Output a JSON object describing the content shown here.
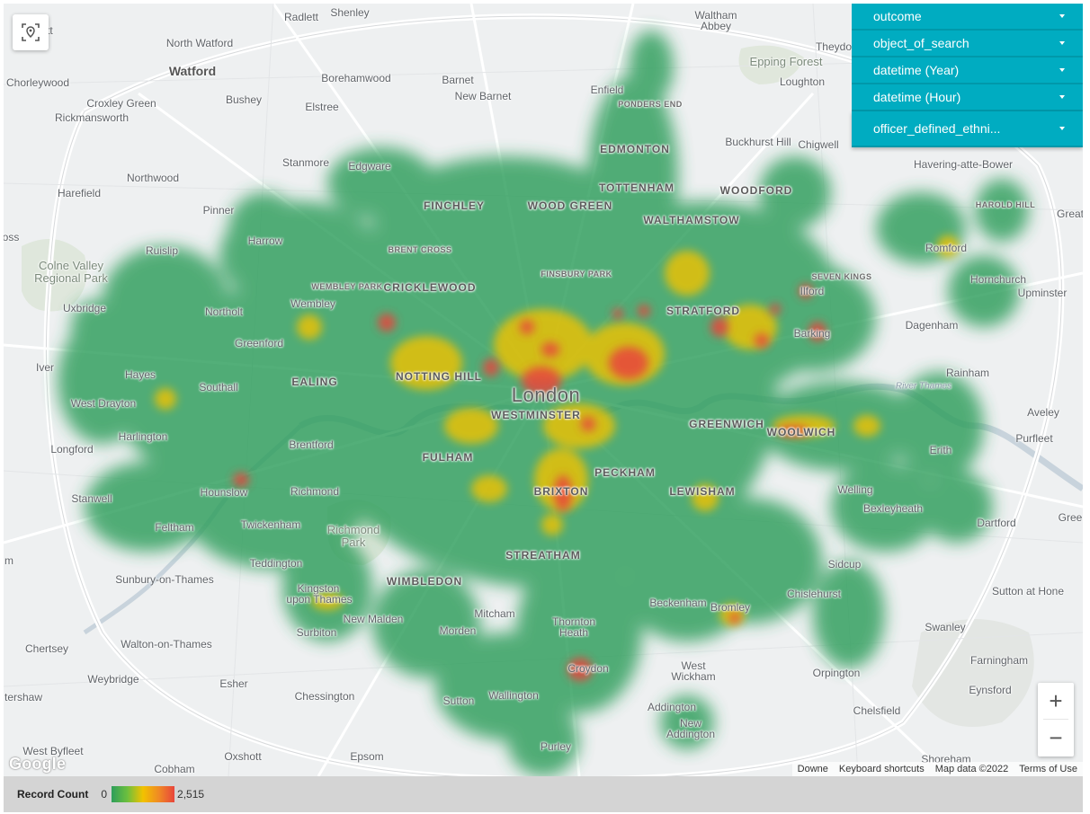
{
  "filters": [
    {
      "label": "outcome"
    },
    {
      "label": "object_of_search"
    },
    {
      "label": "datetime (Year)"
    },
    {
      "label": "datetime (Hour)"
    },
    {
      "label": "officer_defined_ethni..."
    }
  ],
  "legend": {
    "title": "Record Count",
    "min": "0",
    "max": "2,515",
    "colors": [
      "#2e9e5b",
      "#6cbf3e",
      "#f2c200",
      "#f08a24",
      "#e8453c"
    ]
  },
  "attribution": {
    "shortcuts": "Keyboard shortcuts",
    "map_data": "Map data ©2022",
    "terms": "Terms of Use",
    "downe": "Downe"
  },
  "google_logo": "Google",
  "zoom": {
    "in": "+",
    "out": "−"
  },
  "icons": {
    "locate": "locate-icon",
    "zoom_in": "plus-icon",
    "zoom_out": "minus-icon"
  },
  "places": {
    "radlett": "Radlett",
    "shenley": "Shenley",
    "waltham_abbey_1": "Waltham",
    "waltham_abbey_2": "Abbey",
    "theydon_bois": "Theydon B",
    "garratt": "Garratt",
    "north_watford": "North Watford",
    "watford": "Watford",
    "epping_forest": "Epping Forest",
    "loughton": "Loughton",
    "chorleywood": "Chorleywood",
    "croxley_green": "Croxley Green",
    "bushey": "Bushey",
    "borehamwood": "Borehamwood",
    "barnet": "Barnet",
    "new_barnet": "New Barnet",
    "enfield": "Enfield",
    "ponders_end": "PONDERS END",
    "rickmansworth": "Rickmansworth",
    "elstree": "Elstree",
    "buckhurst_hill": "Buckhurst Hill",
    "chigwell": "Chigwell",
    "edmonton": "EDMONTON",
    "havering": "Havering-atte-Bower",
    "stanmore": "Stanmore",
    "edgware": "Edgware",
    "northwood": "Northwood",
    "tottenham": "TOTTENHAM",
    "woodford": "WOODFORD",
    "harefield": "Harefield",
    "finchley": "FINCHLEY",
    "wood_green": "WOOD GREEN",
    "harold_hill": "HAROLD HILL",
    "great": "Great",
    "pinner": "Pinner",
    "walthamstow": "WALTHAMSTOW",
    "harrow": "Harrow",
    "oss": "oss",
    "romford": "Romford",
    "ruislip": "Ruislip",
    "brent_cross": "BRENT CROSS",
    "colne_valley_1": "Colne Valley",
    "colne_valley_2": "Regional Park",
    "finsbury_park": "FINSBURY PARK",
    "seven_kings": "SEVEN KINGS",
    "hornchurch": "Hornchurch",
    "upminster": "Upminster",
    "ilford": "Ilford",
    "wembley_park": "WEMBLEY PARK",
    "cricklewood": "CRICKLEWOOD",
    "uxbridge": "Uxbridge",
    "wembley": "Wembley",
    "northolt": "Northolt",
    "stratford": "STRATFORD",
    "dagenham": "Dagenham",
    "barking": "Barking",
    "greenford": "Greenford",
    "iver": "Iver",
    "hayes": "Hayes",
    "notting_hill": "NOTTING HILL",
    "rainham": "Rainham",
    "ealing": "EALING",
    "southall": "Southall",
    "london": "London",
    "river_thames_east": "River Thames",
    "west_drayton": "West Drayton",
    "westminster": "WESTMINSTER",
    "greenwich": "GREENWICH",
    "aveley": "Aveley",
    "woolwich": "WOOLWICH",
    "purfleet": "Purfleet",
    "harlington": "Harlington",
    "brentford": "Brentford",
    "longford": "Longford",
    "fulham": "FULHAM",
    "erith": "Erith",
    "peckham": "PECKHAM",
    "brixton": "BRIXTON",
    "lewisham": "LEWISHAM",
    "hounslow": "Hounslow",
    "richmond": "Richmond",
    "welling": "Welling",
    "stanwell": "Stanwell",
    "bexleyheath": "Bexleyheath",
    "twickenham": "Twickenham",
    "dartford": "Dartford",
    "gree": "Gree",
    "feltham": "Feltham",
    "richmond_park_1": "Richmond",
    "richmond_park_2": "Park",
    "streatham": "STREATHAM",
    "m": "m",
    "teddington": "Teddington",
    "sidcup": "Sidcup",
    "wimbledon": "WIMBLEDON",
    "sunbury": "Sunbury-on-Thames",
    "kingston_1": "Kingston",
    "kingston_2": "upon Thames",
    "chislehurst": "Chislehurst",
    "sutton_at_hone": "Sutton at Hone",
    "beckenham": "Beckenham",
    "new_malden": "New Malden",
    "mitcham": "Mitcham",
    "bromley": "Bromley",
    "thornton_heath_1": "Thornton",
    "thornton_heath_2": "Heath",
    "swanley": "Swanley",
    "chertsey": "Chertsey",
    "walton": "Walton-on-Thames",
    "surbiton": "Surbiton",
    "morden": "Morden",
    "farningham": "Farningham",
    "croydon": "Croydon",
    "west_wickham_1": "West",
    "west_wickham_2": "Wickham",
    "orpington": "Orpington",
    "weybridge": "Weybridge",
    "esher": "Esher",
    "eynsford": "Eynsford",
    "chessington": "Chessington",
    "wallington": "Wallington",
    "tershaw": "tershaw",
    "sutton": "Sutton",
    "addington": "Addington",
    "chelsfield": "Chelsfield",
    "new_addington_1": "New",
    "new_addington_2": "Addington",
    "west_byfleet": "West Byfleet",
    "purley": "Purley",
    "oxshott": "Oxshott",
    "epsom": "Epsom",
    "shoreham": "Shoreham",
    "cobham": "Cobham"
  }
}
